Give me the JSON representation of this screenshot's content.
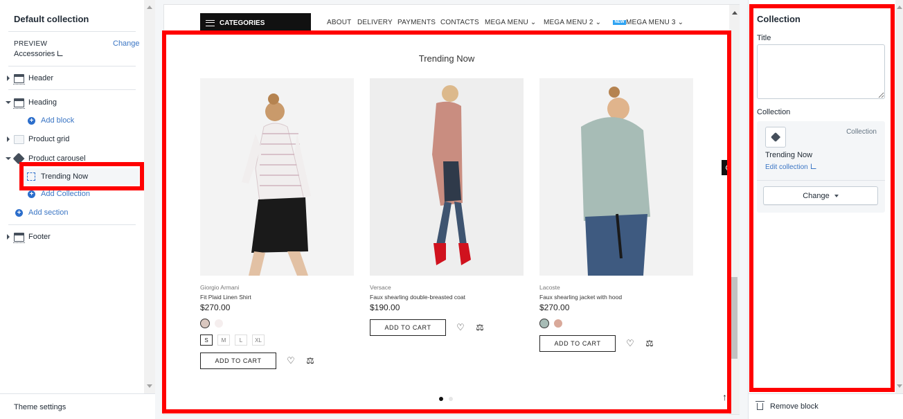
{
  "left": {
    "title": "Default collection",
    "preview_label": "PREVIEW",
    "preview_change": "Change",
    "preview_value": "Accessories",
    "sections": [
      {
        "label": "Header"
      },
      {
        "label": "Heading"
      },
      {
        "label": "Product grid"
      },
      {
        "label": "Product carousel"
      },
      {
        "label": "Footer"
      }
    ],
    "add_block": "Add block",
    "selected_block": "Trending Now",
    "add_collection": "Add Collection",
    "add_section": "Add section",
    "theme_settings": "Theme settings"
  },
  "preview": {
    "nav": {
      "categories": "CATEGORIES",
      "links": [
        "ABOUT",
        "DELIVERY",
        "PAYMENTS",
        "CONTACTS",
        "MEGA MENU",
        "MEGA MENU 2",
        "MEGA MENU 3"
      ],
      "new_badge": "NEW"
    },
    "section_title": "Trending Now",
    "add_to_cart": "ADD TO CART",
    "products": [
      {
        "vendor": "Giorgio Armani",
        "name": "Fit Plaid Linen Shirt",
        "price": "$270.00",
        "sizes": [
          "S",
          "M",
          "L",
          "XL"
        ]
      },
      {
        "vendor": "Versace",
        "name": "Faux shearling double-breasted coat",
        "price": "$190.00"
      },
      {
        "vendor": "Lacoste",
        "name": "Faux shearling jacket with hood",
        "price": "$270.00"
      }
    ]
  },
  "right": {
    "title": "Collection",
    "title_field_label": "Title",
    "collection_label": "Collection",
    "collection_type": "Collection",
    "collection_name": "Trending Now",
    "edit_collection": "Edit collection",
    "change_button": "Change",
    "remove_block": "Remove block"
  },
  "colors": {
    "highlight": "#ff0000",
    "link": "#3a75c4",
    "accent_blue": "#2c6ecb",
    "new_badge": "#2ea3f2"
  }
}
